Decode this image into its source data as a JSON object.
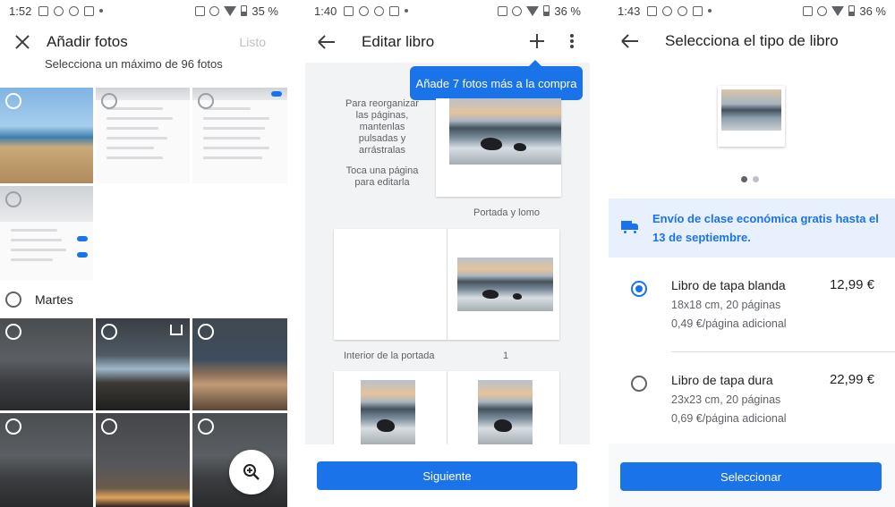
{
  "panel1": {
    "status": {
      "time": "1:52",
      "battery": "35 %"
    },
    "title": "Añadir fotos",
    "done_label": "Listo",
    "subtitle": "Selecciona un máximo de 96 fotos",
    "day_label": "Martes"
  },
  "panel2": {
    "status": {
      "time": "1:40",
      "battery": "36 %"
    },
    "title": "Editar libro",
    "tooltip": "Añade 7 fotos más a la compra",
    "hint_reorder": "Para reorganizar las páginas, mantenlas pulsadas y arrástralas",
    "hint_edit": "Toca una página para editarla",
    "cover_caption": "Portada y lomo",
    "inside_cover_caption": "Interior de la portada",
    "page_number": "1",
    "next_button": "Siguiente"
  },
  "panel3": {
    "status": {
      "time": "1:43",
      "battery": "36 %"
    },
    "title": "Selecciona el tipo de libro",
    "shipping_text": "Envío de clase económica gratis hasta el 13 de septiembre.",
    "options": [
      {
        "name": "Libro de tapa blanda",
        "price": "12,99 €",
        "size": "18x18 cm, 20 páginas",
        "extra": "0,49 €/página adicional",
        "selected": true
      },
      {
        "name": "Libro de tapa dura",
        "price": "22,99 €",
        "size": "23x23 cm, 20 páginas",
        "extra": "0,69 €/página adicional",
        "selected": false
      }
    ],
    "select_button": "Seleccionar"
  },
  "colors": {
    "accent": "#1a73e8",
    "shipping_bg": "#e8f0fe"
  }
}
